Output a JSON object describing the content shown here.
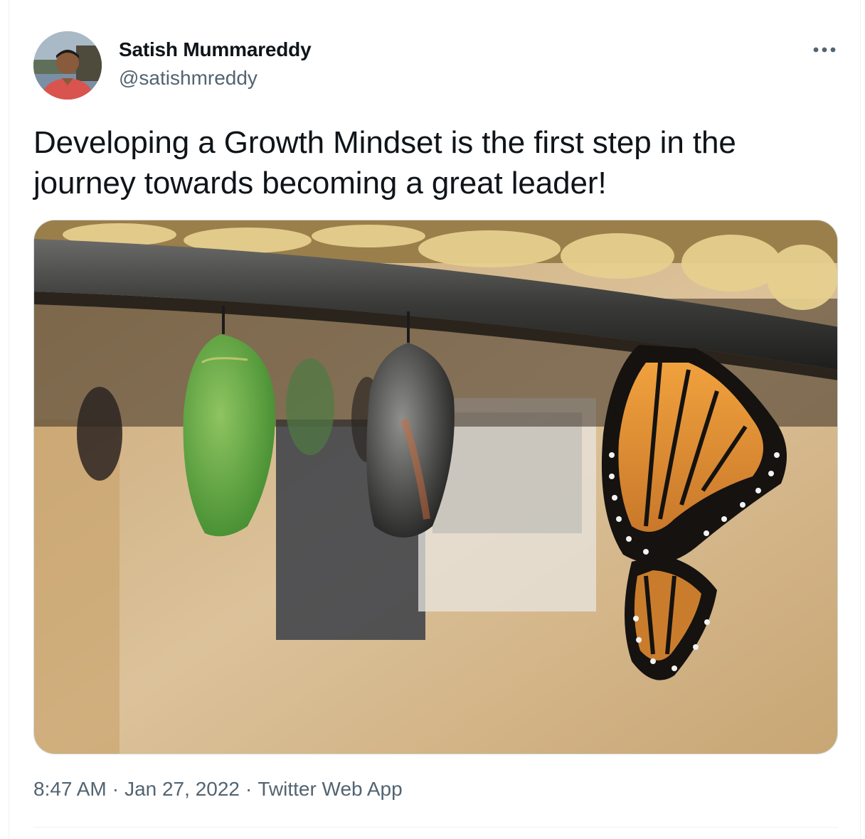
{
  "author": {
    "display_name": "Satish Mummareddy",
    "handle": "@satishmreddy",
    "avatar_icon": "user-avatar"
  },
  "tweet": {
    "text": "Developing a Growth Mindset is the first step in the journey towards becoming a great leader!",
    "media_icon": "photo-chrysalis-butterfly"
  },
  "meta": {
    "time": "8:47 AM",
    "separator": "·",
    "date": "Jan 27, 2022",
    "source": "Twitter Web App"
  },
  "colors": {
    "text_primary": "#0f1419",
    "text_secondary": "#536471",
    "border": "#eff3f4"
  },
  "icons": {
    "more": "more-icon"
  }
}
